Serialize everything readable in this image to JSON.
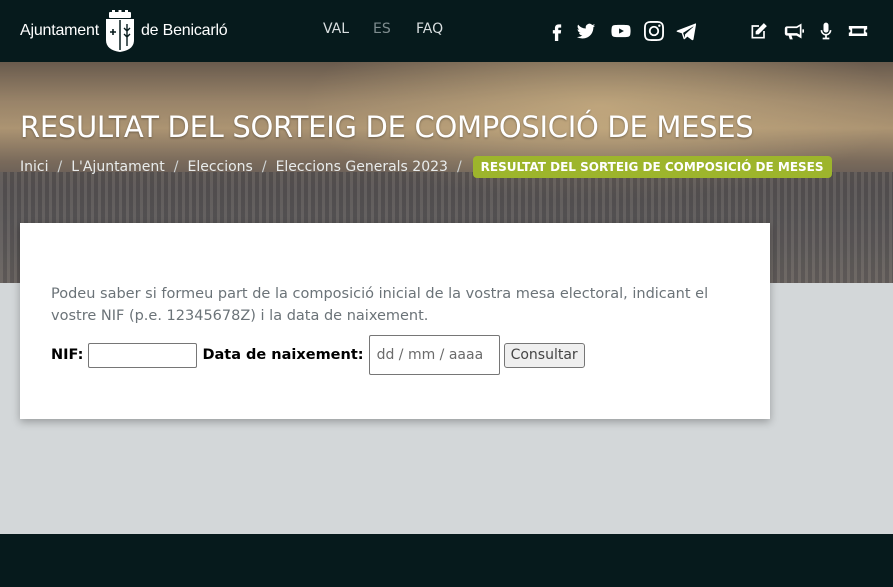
{
  "header": {
    "logo_left": "Ajuntament",
    "logo_right": "de Benicarló",
    "languages": [
      {
        "label": "VAL",
        "active": false
      },
      {
        "label": "ES",
        "active": true
      },
      {
        "label": "FAQ",
        "active": false
      }
    ],
    "social_icons": [
      "facebook-icon",
      "twitter-icon",
      "youtube-icon",
      "instagram-icon",
      "telegram-icon"
    ],
    "action_icons": [
      "edit-icon",
      "megaphone-icon",
      "microphone-icon",
      "ticket-icon"
    ]
  },
  "hero": {
    "title": "RESULTAT DEL SORTEIG DE COMPOSICIÓ DE MESES",
    "breadcrumb": [
      "Inici",
      "L'Ajuntament",
      "Eleccions",
      "Eleccions Generals 2023"
    ],
    "breadcrumb_current": "RESULTAT DEL SORTEIG DE COMPOSICIÓ DE MESES"
  },
  "form": {
    "intro": "Podeu saber si formeu part de la composició inicial de la vostra mesa electoral, indicant el vostre NIF (p.e. 12345678Z) i la data de naixement.",
    "nif_label": "NIF:",
    "nif_value": "",
    "date_label": "Data de naixement:",
    "date_placeholder": "dd / mm / aaaa",
    "submit_label": "Consultar"
  },
  "colors": {
    "header_bg": "#061a1c",
    "breadcrumb_badge": "#9db52c",
    "page_bg": "#d3d7d9"
  }
}
